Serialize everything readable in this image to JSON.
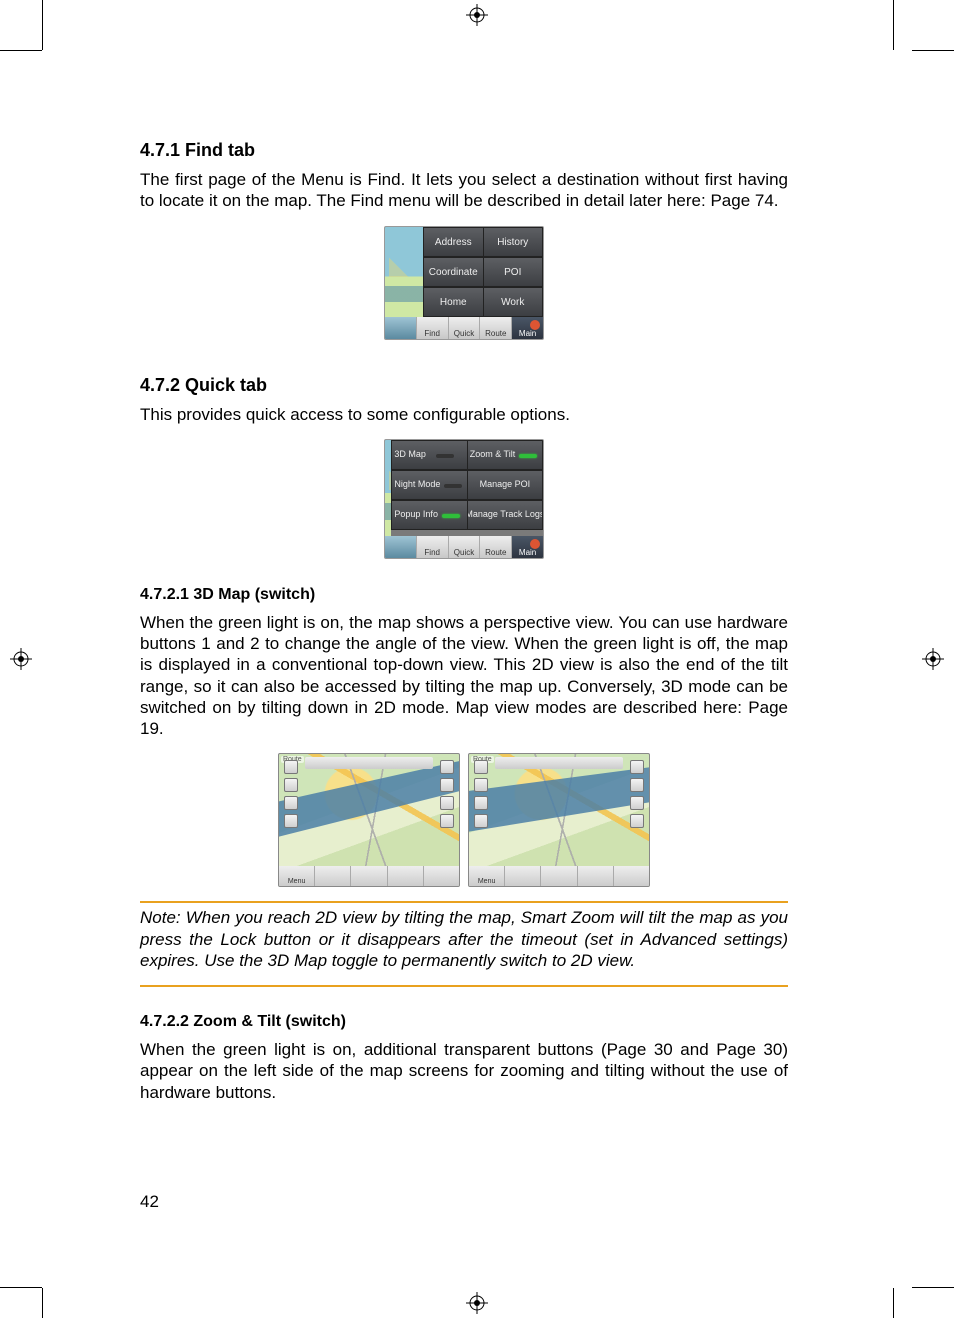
{
  "sections": {
    "s471": {
      "heading": "4.7.1  Find tab",
      "para": "The first page of the Menu is Find. It lets you select a destination without first having to locate it on the map. The Find menu will be described in detail later here: Page 74."
    },
    "s472": {
      "heading": "4.7.2  Quick tab",
      "para": "This provides quick access to some configurable options."
    },
    "s4721": {
      "heading": "4.7.2.1  3D Map (switch)",
      "para": "When the green light is on, the map shows a perspective view. You can use hardware buttons 1 and 2 to change the angle of the view. When the green light is off, the map is displayed in a conventional top-down view. This 2D view is also the end of the tilt range, so it can also be accessed by tilting the map up. Conversely, 3D mode can be switched on by tilting down in 2D mode. Map view modes are described here: Page 19."
    },
    "note": "Note: When you reach 2D view by tilting the map, Smart Zoom will tilt the map as you press the Lock button or it disappears after the timeout (set in Advanced settings) expires. Use the 3D Map toggle to permanently switch to 2D view.",
    "s4722": {
      "heading": "4.7.2.2  Zoom & Tilt (switch)",
      "para": "When the green light is on, additional transparent buttons (Page 30 and Page 30) appear on the left side of the map screens for zooming and tilting without the use of hardware buttons."
    }
  },
  "find_menu": {
    "buttons": [
      [
        "Address",
        "History"
      ],
      [
        "Coordinate",
        "POI"
      ],
      [
        "Home",
        "Work"
      ]
    ],
    "tabs": [
      "Find",
      "Quick",
      "Route",
      "Main"
    ]
  },
  "quick_menu": {
    "buttons": [
      {
        "l": "3D Map",
        "r": "Zoom & Tilt",
        "led_l": "off",
        "led_r": "green"
      },
      {
        "l": "Night Mode",
        "r": "Manage POI",
        "led_l": "off"
      },
      {
        "l": "Popup Info",
        "r": "Manage Track Logs",
        "led_l": "green"
      }
    ],
    "tabs": [
      "Find",
      "Quick",
      "Route",
      "Main"
    ]
  },
  "mapshots": {
    "topleft": "Route",
    "bottom": [
      "Menu",
      "",
      "",
      "",
      ""
    ]
  },
  "page_number": "42"
}
